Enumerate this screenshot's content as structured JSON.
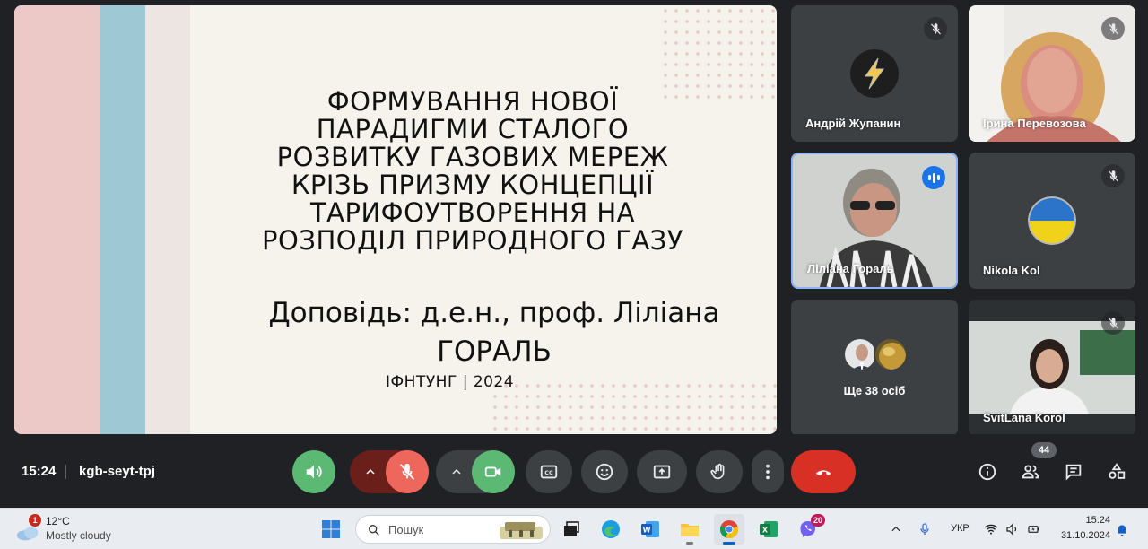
{
  "presentation": {
    "title_lines": [
      "ФОРМУВАННЯ НОВОЇ",
      "ПАРАДИГМИ СТАЛОГО",
      "РОЗВИТКУ ГАЗОВИХ МЕРЕЖ",
      "КРІЗЬ ПРИЗМУ КОНЦЕПЦІЇ",
      "ТАРИФОУТВОРЕННЯ НА",
      "РОЗПОДІЛ ПРИРОДНОГО ГАЗУ"
    ],
    "subtitle_lines": [
      "Доповідь: д.е.н., проф. Ліліана",
      "ГОРАЛЬ"
    ],
    "footer": "ІФНТУНГ | 2024"
  },
  "participants": [
    {
      "name": "Андрій Жупанин",
      "muted": true,
      "avatar": "lightning-logo"
    },
    {
      "name": "Ірина Перевозова",
      "muted": true,
      "avatar": "camera-video"
    },
    {
      "name": "Ліліана Гораль",
      "muted": false,
      "speaking": true,
      "avatar": "camera-video"
    },
    {
      "name": "Nikola Kol",
      "muted": true,
      "avatar": "ukraine-flag"
    },
    {
      "name": "Ще 38 осіб",
      "avatar": "others-stack"
    },
    {
      "name": "SvitLana Korol",
      "muted": true,
      "avatar": "camera-video"
    }
  ],
  "meeting_bar": {
    "time": "15:24",
    "meeting_code": "kgb-seyt-tpj",
    "participant_count": "44",
    "colors": {
      "audio_active": "#5bb974",
      "mic_off": "#ee675c",
      "end_call": "#d93025",
      "surface": "#3c4043"
    }
  },
  "taskbar": {
    "weather_badge": "1",
    "temperature": "12°C",
    "condition": "Mostly cloudy",
    "search_placeholder": "Пошук",
    "notification_count": "20",
    "language": "УКР",
    "time": "15:24",
    "date": "31.10.2024"
  }
}
